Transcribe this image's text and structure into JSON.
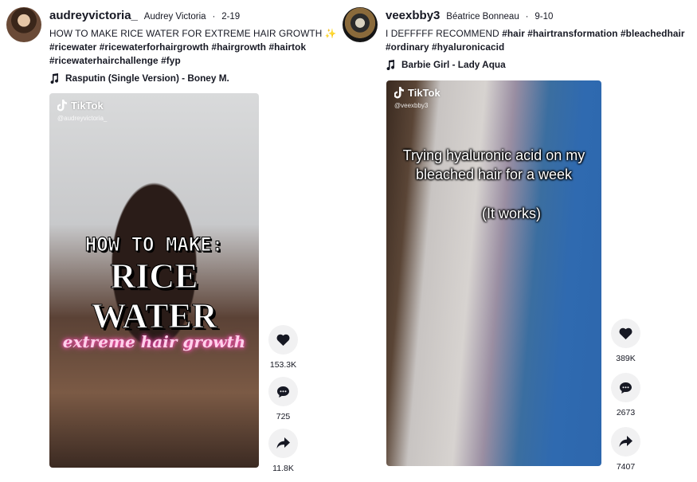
{
  "posts": [
    {
      "username": "audreyvictoria_",
      "nickname": "Audrey Victoria",
      "date": "2-19",
      "description_text": "HOW TO MAKE RICE WATER FOR EXTREME HAIR GROWTH",
      "description_emoji": "✨",
      "hashtags_line1": "#ricewater #ricewaterforhairgrowth #hairgrowth #hairtok",
      "hashtags_line2": "#ricewaterhairchallenge #fyp",
      "music": "Rasputin (Single Version) - Boney M.",
      "video": {
        "brand": "TikTok",
        "handle": "@audreyvictoria_",
        "overlay_line1": "HOW TO MAKE:",
        "overlay_line2": "RICE",
        "overlay_line3": "WATER",
        "overlay_line4": "extreme hair growth"
      },
      "likes": "153.3K",
      "comments": "725",
      "shares": "11.8K"
    },
    {
      "username": "veexbby3",
      "nickname": "Béatrice Bonneau",
      "date": "9-10",
      "description_text": "I DEFFFFF RECOMMEND",
      "hashtags_line1": "#hair #hairtransformation #bleachedhair",
      "hashtags_line2": "#ordinary #hyaluronicacid",
      "music": "Barbie Girl - Lady Aqua",
      "video": {
        "brand": "TikTok",
        "handle": "@veexbby3",
        "overlay_line1": "Trying hyaluronic acid on my bleached hair for a week",
        "overlay_line2": "(It works)"
      },
      "likes": "389K",
      "comments": "2673",
      "shares": "7407"
    }
  ]
}
